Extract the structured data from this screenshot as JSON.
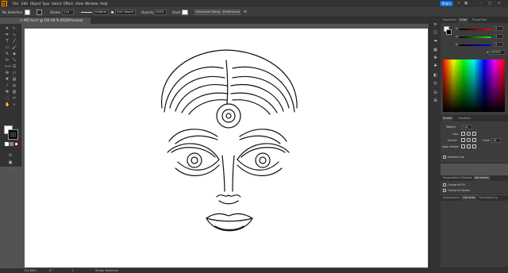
{
  "menubar": {
    "logo": "Ai",
    "items": [
      "File",
      "Edit",
      "Object",
      "Type",
      "Select",
      "Effect",
      "View",
      "Window",
      "Help"
    ],
    "share_label": "Share"
  },
  "controlbar": {
    "selection_label": "No Selection",
    "stroke_label": "Stroke:",
    "stroke_value": "1 pt",
    "profile_value": "Uniform",
    "brush_value": "3 pt. Round",
    "opacity_label": "Opacity:",
    "opacity_value": "100%",
    "style_label": "Style:",
    "document_setup_label": "Document Setup",
    "preferences_label": "Preferences"
  },
  "document": {
    "tab_label": "ART.AI.ai* @ 191.68 % (RGB/Preview)",
    "close_glyph": "×"
  },
  "colors": {
    "accent": "#1473e6",
    "illustrator_orange": "#ff9a00",
    "chrome_dark": "#323232",
    "panel_bg": "#3c3c3c",
    "artboard": "#ffffff",
    "pasteboard": "#535353"
  },
  "panels": {
    "color": {
      "tabs": [
        "Swatches",
        "Color",
        "Properties"
      ],
      "channels": [
        {
          "name": "R",
          "value": "0",
          "gradient": "#000000,#ff0000"
        },
        {
          "name": "G",
          "value": "0",
          "gradient": "#000000,#00ff00"
        },
        {
          "name": "B",
          "value": "0",
          "gradient": "#000000,#0000ff"
        }
      ],
      "hex_value": "FFFFFF"
    },
    "stroke": {
      "tabs": [
        "Stroke",
        "Gradient"
      ],
      "weight_label": "Weight:",
      "weight_value": "1 pt",
      "cap_label": "Cap:",
      "corner_label": "Corner:",
      "limit_label": "Limit:",
      "limit_value": "10",
      "align_label": "Align Stroke:",
      "dashed_label": "Dashed Line"
    },
    "attributes": {
      "tabs": [
        "Separations Preview",
        "Attributes"
      ],
      "overprint_fill": "Overprint Fill",
      "overprint_stroke": "Overprint Stroke"
    },
    "bottom_tabs": [
      "Appearance",
      "Libraries",
      "Transparency"
    ]
  },
  "statusbar": {
    "zoom": "191.68%",
    "angle": "0°",
    "artboard": "1",
    "tool": "Shape Selection"
  },
  "icons": {
    "tools": [
      "selection-icon",
      "direct-selection-icon",
      "pen-icon",
      "curvature-icon",
      "type-icon",
      "line-icon",
      "rectangle-icon",
      "paintbrush-icon",
      "pencil-icon",
      "eraser-icon",
      "rotate-icon",
      "scale-icon",
      "width-icon",
      "free-transform-icon",
      "shape-builder-icon",
      "perspective-icon",
      "mesh-icon",
      "gradient-icon",
      "eyedropper-icon",
      "blend-icon",
      "symbol-sprayer-icon",
      "graph-icon",
      "artboard-icon",
      "slice-icon",
      "hand-icon",
      "zoom-icon"
    ]
  }
}
